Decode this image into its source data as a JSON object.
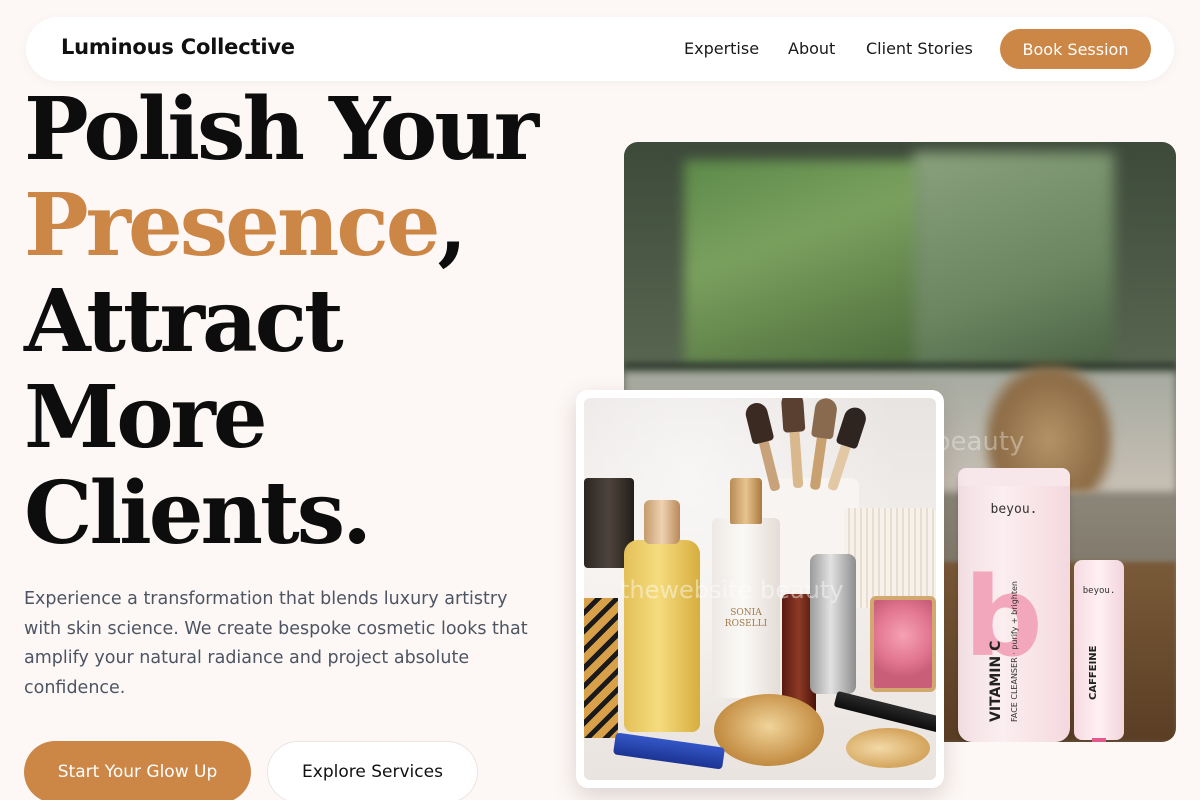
{
  "nav": {
    "brand": "Luminous Collective",
    "links": [
      "Expertise",
      "About",
      "Client Stories"
    ],
    "cta": "Book Session"
  },
  "hero": {
    "headline": {
      "line1": "Polish Your",
      "accent": "Presence",
      "accent_punct": ",",
      "line3": "Attract",
      "line4": "More",
      "line5": "Clients."
    },
    "description": "Experience a transformation that blends luxury artistry with skin science. We create bespoke cosmetic looks that amplify your natural radiance and project absolute confidence.",
    "primary_cta": "Start Your Glow Up",
    "secondary_cta": "Explore Services"
  },
  "images": {
    "main_product": {
      "tube_brand": "beyou.",
      "tube_label": "VITAMIN C",
      "tube_sub": "FACE CLEANSER · purify + brighten",
      "small_tube_brand": "beyou.",
      "small_tube_label": "CAFFEINE",
      "watermark": "beauty"
    },
    "inset_product": {
      "bottle_label": "SONIA ROSELLI",
      "watermark": "thewebsite beauty"
    }
  },
  "colors": {
    "accent": "#cc8646",
    "background": "#fdf8f6",
    "text": "#0d0d0d",
    "muted": "#4d5563"
  }
}
